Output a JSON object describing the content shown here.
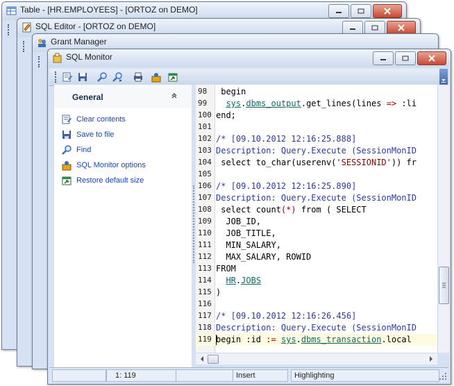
{
  "back_windows": [
    {
      "title": "Table - [HR.EMPLOYEES] - [ORTOZ on DEMO]"
    },
    {
      "title": "SQL Editor - [ORTOZ on DEMO]"
    },
    {
      "title": "Grant Manager"
    }
  ],
  "main_window": {
    "title": "SQL Monitor",
    "toolbar_icons": [
      "clear-contents-icon",
      "save-icon",
      "find-icon",
      "find-next-icon",
      "print-icon",
      "options-icon",
      "restore-icon"
    ]
  },
  "nav_pane": {
    "header": "General",
    "collapse_glyph": "ˆ",
    "items": [
      {
        "label": "Clear contents"
      },
      {
        "label": "Save to file"
      },
      {
        "label": "Find"
      },
      {
        "label": "SQL Monitor options"
      },
      {
        "label": "Restore default size"
      }
    ]
  },
  "editor": {
    "lines": [
      {
        "n": "98",
        "text": " begin"
      },
      {
        "n": "99",
        "text": "  sys.dbms_output.get_lines(lines => :li"
      },
      {
        "n": "100",
        "text": "end;"
      },
      {
        "n": "101",
        "text": ""
      },
      {
        "n": "102",
        "text": "/* [09.10.2012 12:16:25.888]"
      },
      {
        "n": "103",
        "text": "Description: Query.Execute (SessionMonID"
      },
      {
        "n": "104",
        "text": " select to_char(userenv('SESSIONID')) fr"
      },
      {
        "n": "105",
        "text": ""
      },
      {
        "n": "106",
        "text": "/* [09.10.2012 12:16:25.890]"
      },
      {
        "n": "107",
        "text": "Description: Query.Execute (SessionMonID"
      },
      {
        "n": "108",
        "text": " select count(*) from ( SELECT"
      },
      {
        "n": "109",
        "text": "  JOB_ID,"
      },
      {
        "n": "110",
        "text": "  JOB_TITLE,"
      },
      {
        "n": "111",
        "text": "  MIN_SALARY,"
      },
      {
        "n": "112",
        "text": "  MAX_SALARY, ROWID"
      },
      {
        "n": "113",
        "text": "FROM"
      },
      {
        "n": "114",
        "text": "  HR.JOBS"
      },
      {
        "n": "115",
        "text": ")"
      },
      {
        "n": "116",
        "text": ""
      },
      {
        "n": "117",
        "text": "/* [09.10.2012 12:16:26.456]"
      },
      {
        "n": "118",
        "text": "Description: Query.Execute (SessionMonID"
      },
      {
        "n": "119",
        "text": "begin :id := sys.dbms_transaction.local"
      }
    ]
  },
  "statusbar": {
    "position": "1:  119",
    "mode": "Insert",
    "highlight": "Highlighting"
  },
  "colors": {
    "accent": "#1846b8",
    "comment": "#2b3a9e",
    "package": "#0a6a6a",
    "string": "#7a0a0a"
  }
}
